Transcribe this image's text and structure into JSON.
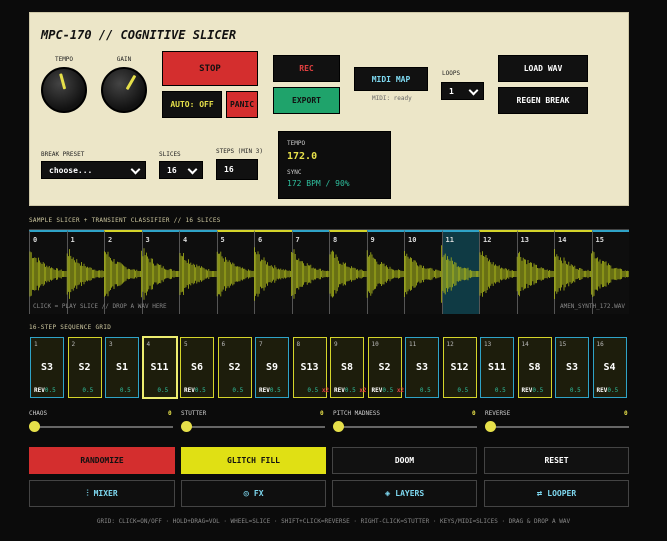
{
  "title": "MPC-170 // COGNITIVE SLICER",
  "knobs": {
    "tempo_label": "TEMPO",
    "gain_label": "GAIN"
  },
  "buttons": {
    "stop": "STOP",
    "rec": "REC",
    "midi_map": "MIDI MAP",
    "load_wav": "LOAD WAV",
    "auto": "AUTO: OFF",
    "panic": "PANIC",
    "export": "EXPORT",
    "regen_break": "REGEN BREAK"
  },
  "midi_status": "MIDI: ready",
  "loops": {
    "label": "LOOPS",
    "value": "1"
  },
  "break_preset": {
    "label": "BREAK PRESET",
    "value": "choose..."
  },
  "slices": {
    "label": "SLICES",
    "value": "16"
  },
  "steps": {
    "label": "STEPS (MIN 3)",
    "value": "16"
  },
  "display": {
    "tempo_label": "TEMPO",
    "tempo_value": "172.0",
    "sync_label": "SYNC",
    "sync_value": "172 BPM / 90%"
  },
  "slicer": {
    "header": "SAMPLE SLICER + TRANSIENT CLASSIFIER // 16 SLICES",
    "hint": "CLICK = PLAY SLICE  //  DROP A WAV HERE",
    "filename": "AMEN_SYNTH_172.WAV",
    "active_slice": 11,
    "slices": [
      {
        "n": "0",
        "c": "b"
      },
      {
        "n": "1",
        "c": "b"
      },
      {
        "n": "2",
        "c": "y"
      },
      {
        "n": "3",
        "c": "b"
      },
      {
        "n": "4",
        "c": "b"
      },
      {
        "n": "5",
        "c": "y"
      },
      {
        "n": "6",
        "c": "y"
      },
      {
        "n": "7",
        "c": "b"
      },
      {
        "n": "8",
        "c": "y"
      },
      {
        "n": "9",
        "c": "b"
      },
      {
        "n": "10",
        "c": "b"
      },
      {
        "n": "11",
        "c": "b"
      },
      {
        "n": "12",
        "c": "y"
      },
      {
        "n": "13",
        "c": "y"
      },
      {
        "n": "14",
        "c": "y"
      },
      {
        "n": "15",
        "c": "b"
      }
    ]
  },
  "grid": {
    "header": "16-STEP SEQUENCE GRID",
    "active_step": 4,
    "steps": [
      {
        "n": "1",
        "s": "S3",
        "rev": "REV",
        "v": "0.5",
        "x": "",
        "c": "b"
      },
      {
        "n": "2",
        "s": "S2",
        "rev": "",
        "v": "0.5",
        "x": "",
        "c": "y"
      },
      {
        "n": "3",
        "s": "S1",
        "rev": "",
        "v": "0.5",
        "x": "",
        "c": "b"
      },
      {
        "n": "4",
        "s": "S11",
        "rev": "",
        "v": "0.5",
        "x": "",
        "c": "y"
      },
      {
        "n": "5",
        "s": "S6",
        "rev": "REV",
        "v": "0.5",
        "x": "",
        "c": "y"
      },
      {
        "n": "6",
        "s": "S2",
        "rev": "",
        "v": "0.5",
        "x": "",
        "c": "y"
      },
      {
        "n": "7",
        "s": "S9",
        "rev": "REV",
        "v": "0.5",
        "x": "",
        "c": "b"
      },
      {
        "n": "8",
        "s": "S13",
        "rev": "",
        "v": "0.5",
        "x": "x2",
        "c": "y"
      },
      {
        "n": "9",
        "s": "S8",
        "rev": "REV",
        "v": "0.5",
        "x": "x2",
        "c": "y"
      },
      {
        "n": "10",
        "s": "S2",
        "rev": "REV",
        "v": "0.5",
        "x": "x2",
        "c": "y"
      },
      {
        "n": "11",
        "s": "S3",
        "rev": "",
        "v": "0.5",
        "x": "",
        "c": "b"
      },
      {
        "n": "12",
        "s": "S12",
        "rev": "",
        "v": "0.5",
        "x": "",
        "c": "y"
      },
      {
        "n": "13",
        "s": "S11",
        "rev": "",
        "v": "0.5",
        "x": "",
        "c": "b"
      },
      {
        "n": "14",
        "s": "S8",
        "rev": "REV",
        "v": "0.5",
        "x": "",
        "c": "y"
      },
      {
        "n": "15",
        "s": "S3",
        "rev": "",
        "v": "0.5",
        "x": "",
        "c": "b"
      },
      {
        "n": "16",
        "s": "S4",
        "rev": "REV",
        "v": "0.5",
        "x": "",
        "c": "b"
      }
    ]
  },
  "sliders": [
    {
      "label": "CHAOS",
      "value": "0"
    },
    {
      "label": "STUTTER",
      "value": "0"
    },
    {
      "label": "PITCH MADNESS",
      "value": "0"
    },
    {
      "label": "REVERSE",
      "value": "0"
    }
  ],
  "actions": {
    "randomize": "RANDOMIZE",
    "glitch_fill": "GLITCH FILL",
    "doom": "DOOM",
    "reset": "RESET"
  },
  "nav": {
    "mixer": "MIXER",
    "fx": "FX",
    "layers": "LAYERS",
    "looper": "LOOPER"
  },
  "footer": "GRID: CLICK=ON/OFF · HOLD+DRAG=VOL · WHEEL=SLICE · SHIFT+CLICK=REVERSE · RIGHT-CLICK=STUTTER · KEYS/MIDI=SLICES · DRAG & DROP A WAV",
  "colors": {
    "panel": "#ece6c8",
    "accent_yellow": "#e6e04a",
    "accent_cyan": "#2fa3c7",
    "stop_red": "#d42e2e",
    "export_green": "#1fa36b"
  }
}
